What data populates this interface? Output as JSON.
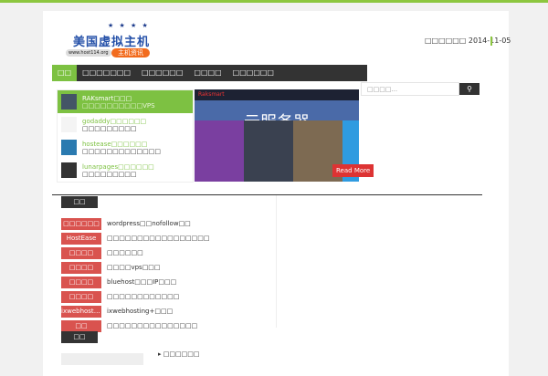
{
  "logo": {
    "stars": "★ ★ ★ ★",
    "name": "美国虚拟主机",
    "url": "www.host114.org",
    "badge": "主机资讯"
  },
  "header": {
    "date_label": "□□□□□□",
    "date": "2014-11-05"
  },
  "nav": [
    "□□",
    "□□□□□□□",
    "□□□□□□",
    "□□□□",
    "□□□□□□"
  ],
  "slider": {
    "items": [
      {
        "title": "RAKsmart□□□",
        "sub": "□□□□□□□□□□VPS"
      },
      {
        "title": "godaddy□□□□□□",
        "sub": "□□□□□□□□□"
      },
      {
        "title": "hostease□□□□□□",
        "sub": "□□□□□□□□□□□□□"
      },
      {
        "title": "lunarpages□□□□□□",
        "sub": "□□□□□□□□□"
      }
    ],
    "hero_brand": "Raksmart",
    "hero_title": "云服务器",
    "read_more": "Read More"
  },
  "search": {
    "placeholder": "□□□□...",
    "button_icon": "search-icon"
  },
  "tabs": {
    "first": "□□",
    "second": "□□"
  },
  "tag_rows": [
    {
      "tag": "□□□□□□",
      "text": "wordpress□□nofollow□□"
    },
    {
      "tag": "HostEase",
      "text": "□□□□□□□□□□□□□□□□□"
    },
    {
      "tag": "□□□□",
      "text": "□□□□□□"
    },
    {
      "tag": "□□□□",
      "text": "□□□□vps□□□"
    },
    {
      "tag": "□□□□",
      "text": "bluehost□□□IP□□□"
    },
    {
      "tag": "□□□□",
      "text": "□□□□□□□□□□□□"
    },
    {
      "tag": "ixwebhosti...",
      "text": "ixwebhosting+□□□"
    },
    {
      "tag": "□□",
      "text": "□□□□□□□□□□□□□□□"
    }
  ],
  "bottom_link": "□□□□□□",
  "colors": {
    "accent": "#7dc142",
    "tag": "#d9534f",
    "dark": "#333333"
  }
}
